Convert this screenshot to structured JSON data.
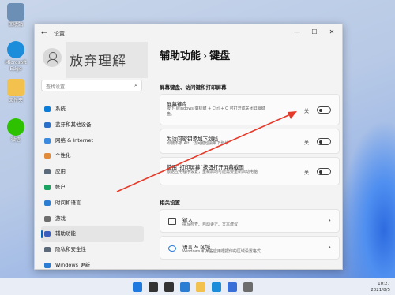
{
  "desktop": {
    "icons": [
      {
        "label": "回收站",
        "color": "#6c8fb6"
      },
      {
        "label": "Microsoft Edge",
        "color": "#1b8ddb"
      },
      {
        "label": "文件夹",
        "color": "#f2c14e"
      },
      {
        "label": "微信",
        "color": "#2dc100"
      }
    ]
  },
  "window": {
    "title": "设置",
    "back_icon": "←",
    "controls": [
      "—",
      "☐",
      "✕"
    ]
  },
  "account": {
    "name_text": "放弃理解"
  },
  "search": {
    "placeholder": "查找设置",
    "icon": "⌕"
  },
  "sidebar": {
    "items": [
      {
        "label": "系统",
        "color": "#0a7bd6"
      },
      {
        "label": "蓝牙和其他设备",
        "color": "#2a6fc9"
      },
      {
        "label": "网络 & Internet",
        "color": "#3a8be0"
      },
      {
        "label": "个性化",
        "color": "#e08a3a"
      },
      {
        "label": "应用",
        "color": "#5a6a7a"
      },
      {
        "label": "帐户",
        "color": "#1aa260"
      },
      {
        "label": "时间和语言",
        "color": "#2b7cd3"
      },
      {
        "label": "游戏",
        "color": "#6d6d6d"
      },
      {
        "label": "辅助功能",
        "color": "#3a5fbf"
      },
      {
        "label": "隐私和安全性",
        "color": "#5a6a7a"
      },
      {
        "label": "Windows 更新",
        "color": "#2b7cd3"
      }
    ],
    "active_index": 8
  },
  "main": {
    "breadcrumb_parent": "辅助功能",
    "breadcrumb_sep": "›",
    "breadcrumb_current": "键盘",
    "section1_label": "屏幕键盘、访问键和打印屏幕",
    "toggles": [
      {
        "title": "屏幕键盘",
        "desc": "按下 Windows 徽标键 + Ctrl + O 可打开或关闭屏幕键盘。",
        "state": "关",
        "on": false
      },
      {
        "title": "为访问密钥添加下划线",
        "desc": "即使不按 Alt，访问键也会带下划线",
        "state": "关",
        "on": false
      },
      {
        "title": "使用“打印屏幕”按钮打开屏幕截图",
        "desc": "根据应用程序设置，重新启动可能需要重新启动电脑",
        "state": "关",
        "on": false
      }
    ],
    "section2_label": "相关设置",
    "links": [
      {
        "title": "键入",
        "desc": "拼写检查、自动更正、文本建议",
        "icon_color": "#444"
      },
      {
        "title": "语言 & 区域",
        "desc": "Windows 和某些应用根据你的区域设置格式",
        "icon_color": "#2b7cd3"
      }
    ]
  },
  "taskbar": {
    "icons": [
      {
        "name": "start",
        "color": "#1f7ae0"
      },
      {
        "name": "search",
        "color": "#333"
      },
      {
        "name": "taskview",
        "color": "#333"
      },
      {
        "name": "widgets",
        "color": "#2b7cd3"
      },
      {
        "name": "explorer",
        "color": "#f2c14e"
      },
      {
        "name": "edge",
        "color": "#1b8ddb"
      },
      {
        "name": "store",
        "color": "#3b6fd8"
      },
      {
        "name": "settings",
        "color": "#6d6d6d"
      }
    ],
    "clock_time": "10:27",
    "clock_date": "2021/8/5"
  },
  "annotation": {
    "arrow_color": "#e53a2a"
  }
}
